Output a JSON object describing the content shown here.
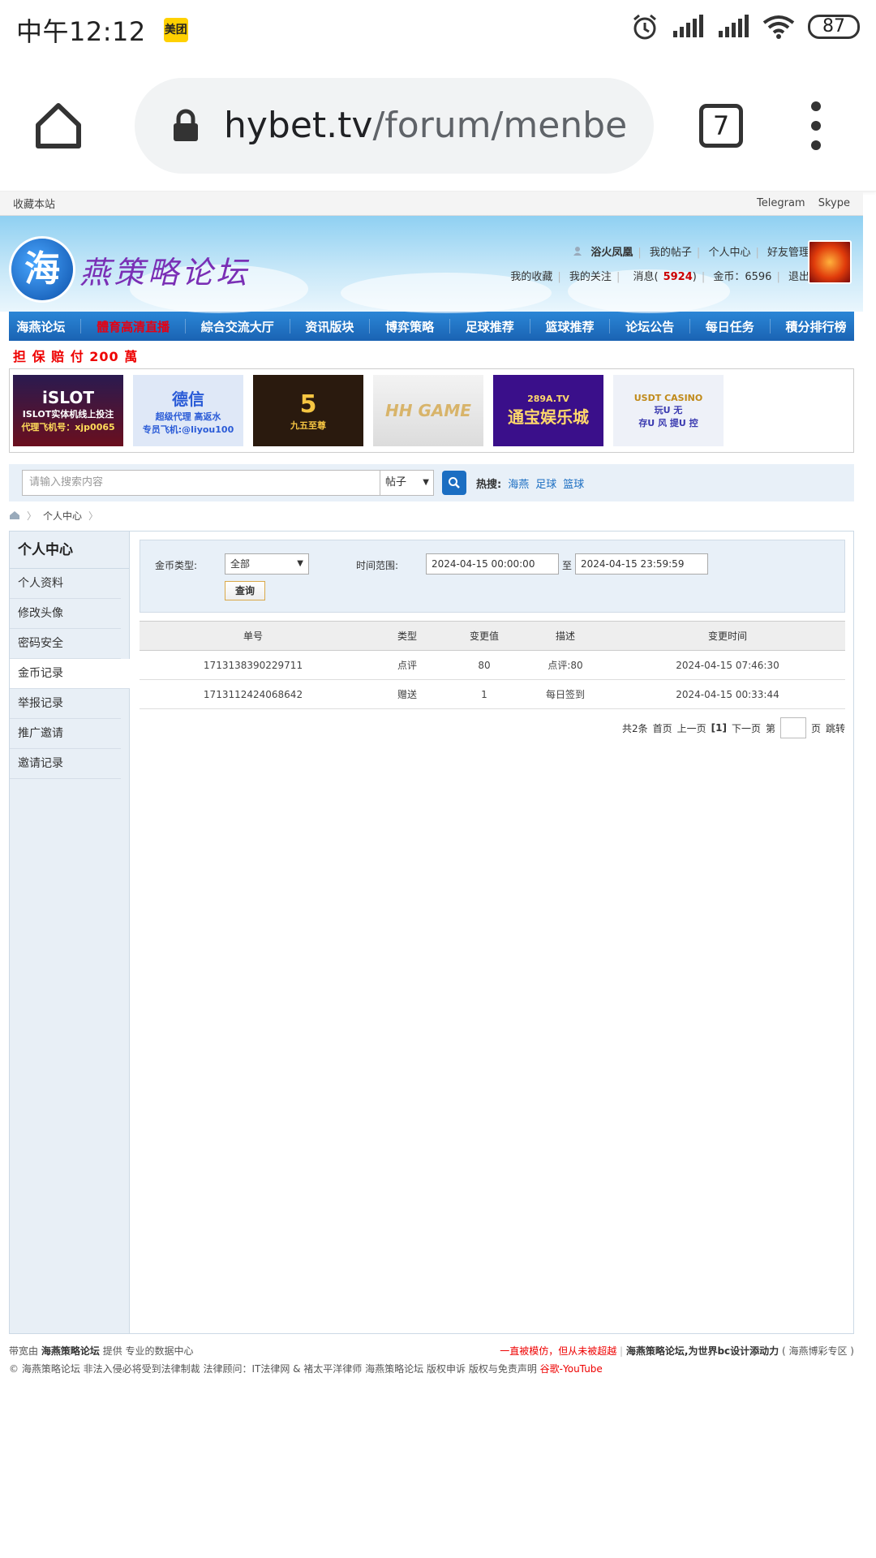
{
  "status_bar": {
    "time": "中午12:12",
    "app_badge": "美团",
    "battery": "87"
  },
  "browser": {
    "url_host": "hybet.tv",
    "url_path": "/forum/menber.h",
    "tab_count": "7"
  },
  "topbar": {
    "bookmark": "收藏本站",
    "telegram": "Telegram",
    "skype": "Skype"
  },
  "header": {
    "logo_char": "海",
    "logo_text": "燕策略论坛",
    "username": "浴火凤凰",
    "my_posts": "我的帖子",
    "user_center": "个人中心",
    "friends": "好友管理",
    "favorites": "我的收藏",
    "follows": "我的关注",
    "messages_label": "消息",
    "messages_count": "5924",
    "coins_label": "金币：6596",
    "logout": "退出"
  },
  "nav": [
    "海燕论坛",
    "體育高清直播",
    "綜合交流大厅",
    "资讯版块",
    "博弈策略",
    "足球推荐",
    "篮球推荐",
    "论坛公告",
    "每日任务",
    "積分排行榜"
  ],
  "guarantee": "担 保 赔 付 200 萬",
  "banners": [
    {
      "title": "iSLOT",
      "line1": "ISLOT实体机线上投注",
      "line2": "代理飞机号：xjp0065"
    },
    {
      "title": "德信",
      "line1": "超级代理 高返水",
      "line2": "专员飞机:@liyou100"
    },
    {
      "title": "九五至尊",
      "line1": "",
      "line2": ""
    },
    {
      "title": "HH GAME",
      "line1": "",
      "line2": ""
    },
    {
      "title": "通宝娱乐城",
      "line1": "289A.TV",
      "line2": ""
    },
    {
      "title": "USDT CASINO",
      "line1": "玩U 无",
      "line2": "存U 风 提U 控"
    }
  ],
  "search": {
    "placeholder": "请输入搜索内容",
    "type": "帖子",
    "hot_label": "热搜:",
    "hot_links": [
      "海燕",
      "足球",
      "篮球"
    ]
  },
  "breadcrumb": {
    "current": "个人中心"
  },
  "sidebar": {
    "title": "个人中心",
    "items": [
      "个人资料",
      "修改头像",
      "密码安全",
      "金币记录",
      "举报记录",
      "推广邀请",
      "邀请记录"
    ]
  },
  "filter": {
    "coin_type_label": "金币类型:",
    "coin_type_value": "全部",
    "time_range_label": "时间范围:",
    "start": "2024-04-15 00:00:00",
    "to": "至",
    "end": "2024-04-15 23:59:59",
    "query": "查询"
  },
  "table": {
    "headers": [
      "单号",
      "类型",
      "变更值",
      "描述",
      "变更时间"
    ],
    "rows": [
      [
        "1713138390229711",
        "点评",
        "80",
        "点评:80",
        "2024-04-15 07:46:30"
      ],
      [
        "1713112424068642",
        "赠送",
        "1",
        "每日签到",
        "2024-04-15 00:33:44"
      ]
    ]
  },
  "pager": {
    "total": "共2条",
    "first": "首页",
    "prev": "上一页",
    "current": "[1]",
    "next": "下一页",
    "page_prefix": "第",
    "page_suffix": "页",
    "jump": "跳转"
  },
  "footer": {
    "left_pre": "带宽由",
    "left_brand": "海燕策略论坛",
    "left_post": "提供 专业的数据中心",
    "slogan": "一直被模仿，但从未被超越",
    "right_brand": "海燕策略论坛,为世界bc设计添动力",
    "right_zone": "( 海燕博彩专区 )",
    "copyright": "© 海燕策略论坛 非法入侵必将受到法律制裁 法律顾问：IT法律网 & 褚太平洋律师",
    "links": [
      "海燕策略论坛",
      "版权申诉",
      "版权与免责声明"
    ],
    "youtube": "谷歌-YouTube"
  }
}
